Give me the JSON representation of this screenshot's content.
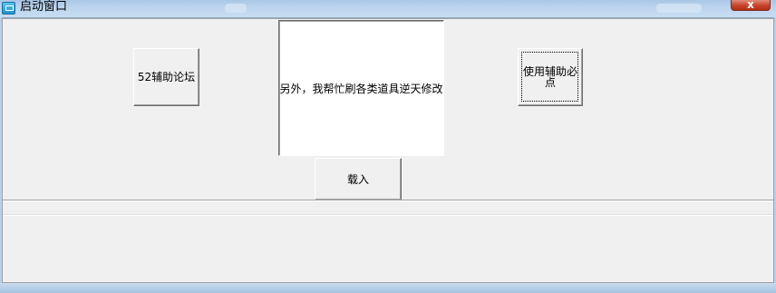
{
  "window": {
    "title": "启动窗口",
    "close_label": "x"
  },
  "buttons": {
    "forum_label": "52辅助论坛",
    "required_label": "使用辅助必点",
    "load_label": "载入"
  },
  "panel": {
    "text": "另外，我帮忙刷各类道具逆天修改"
  },
  "colors": {
    "titlebar": "#bcd5ee",
    "close_button": "#c8432b",
    "client_background": "#f0f0f0",
    "panel_background": "#ffffff"
  },
  "icons": {
    "app": "app-window-icon",
    "close": "close-icon"
  }
}
